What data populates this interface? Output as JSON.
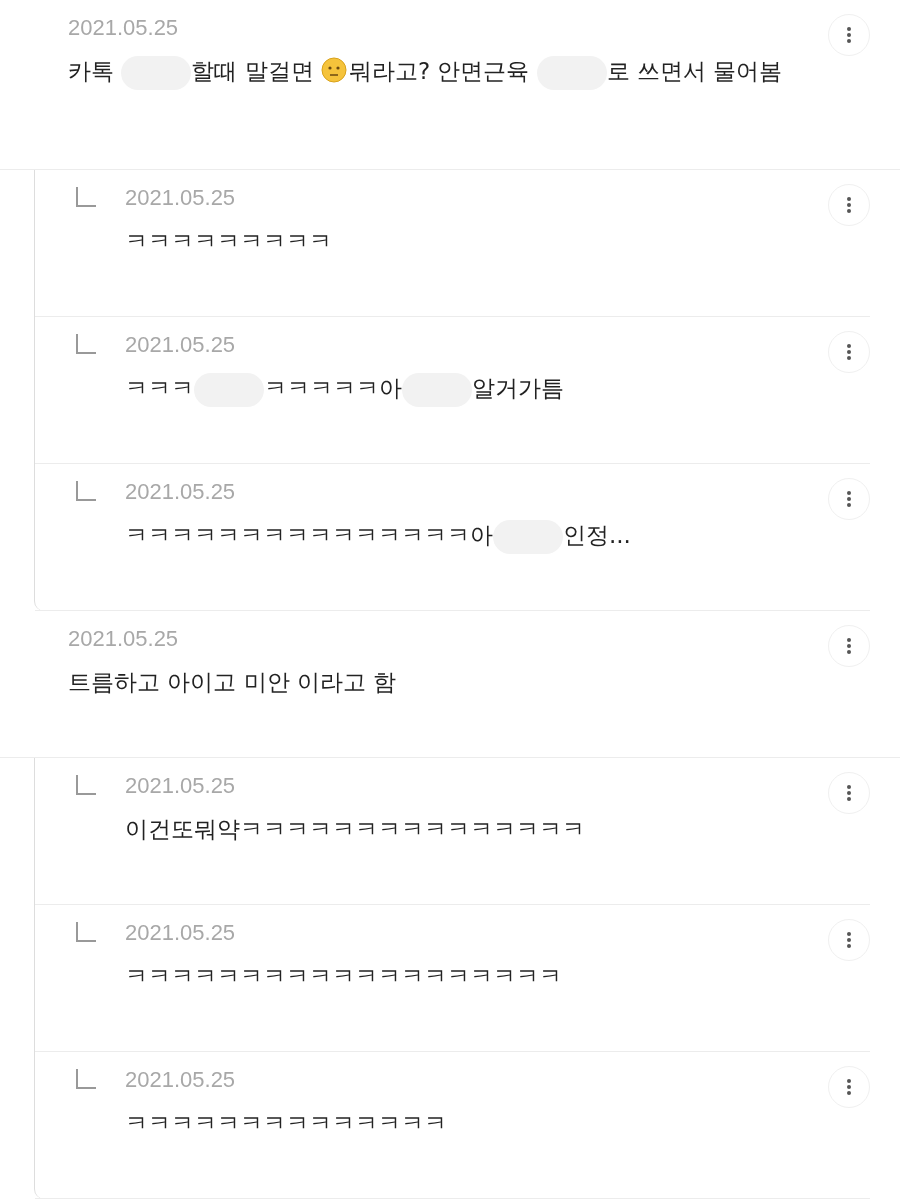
{
  "threads": [
    {
      "date": "2021.05.25",
      "body": [
        {
          "kind": "text",
          "text": "카톡 "
        },
        {
          "kind": "blur"
        },
        {
          "kind": "text",
          "text": "할때 말걸면 "
        },
        {
          "kind": "emoji"
        },
        {
          "kind": "text",
          "text": "뭐라고? 안면근육 "
        },
        {
          "kind": "blur"
        },
        {
          "kind": "text",
          "text": "로 쓰면서 물어봄"
        }
      ],
      "replies": [
        {
          "date": "2021.05.25",
          "body": [
            {
              "kind": "text",
              "text": "ㅋㅋㅋㅋㅋㅋㅋㅋㅋ"
            }
          ]
        },
        {
          "date": "2021.05.25",
          "body": [
            {
              "kind": "text",
              "text": "ㅋㅋㅋ"
            },
            {
              "kind": "blur"
            },
            {
              "kind": "text",
              "text": "ㅋㅋㅋㅋㅋ아"
            },
            {
              "kind": "blur"
            },
            {
              "kind": "text",
              "text": "알거가틈"
            }
          ]
        },
        {
          "date": "2021.05.25",
          "body": [
            {
              "kind": "text",
              "text": "ㅋㅋㅋㅋㅋㅋㅋㅋㅋㅋㅋㅋㅋㅋㅋ아"
            },
            {
              "kind": "blur"
            },
            {
              "kind": "text",
              "text": "인정..."
            }
          ]
        }
      ]
    },
    {
      "date": "2021.05.25",
      "body": [
        {
          "kind": "text",
          "text": "트름하고 아이고 미안 이라고 함"
        }
      ],
      "replies": [
        {
          "date": "2021.05.25",
          "body": [
            {
              "kind": "text",
              "text": "이건또뭐약ㅋㅋㅋㅋㅋㅋㅋㅋㅋㅋㅋㅋㅋㅋㅋ"
            }
          ]
        },
        {
          "date": "2021.05.25",
          "body": [
            {
              "kind": "text",
              "text": "ㅋㅋㅋㅋㅋㅋㅋㅋㅋㅋㅋㅋㅋㅋㅋㅋㅋㅋㅋ"
            }
          ]
        },
        {
          "date": "2021.05.25",
          "body": [
            {
              "kind": "text",
              "text": "ㅋㅋㅋㅋㅋㅋㅋㅋㅋㅋㅋㅋㅋㅋ"
            }
          ]
        }
      ]
    }
  ]
}
